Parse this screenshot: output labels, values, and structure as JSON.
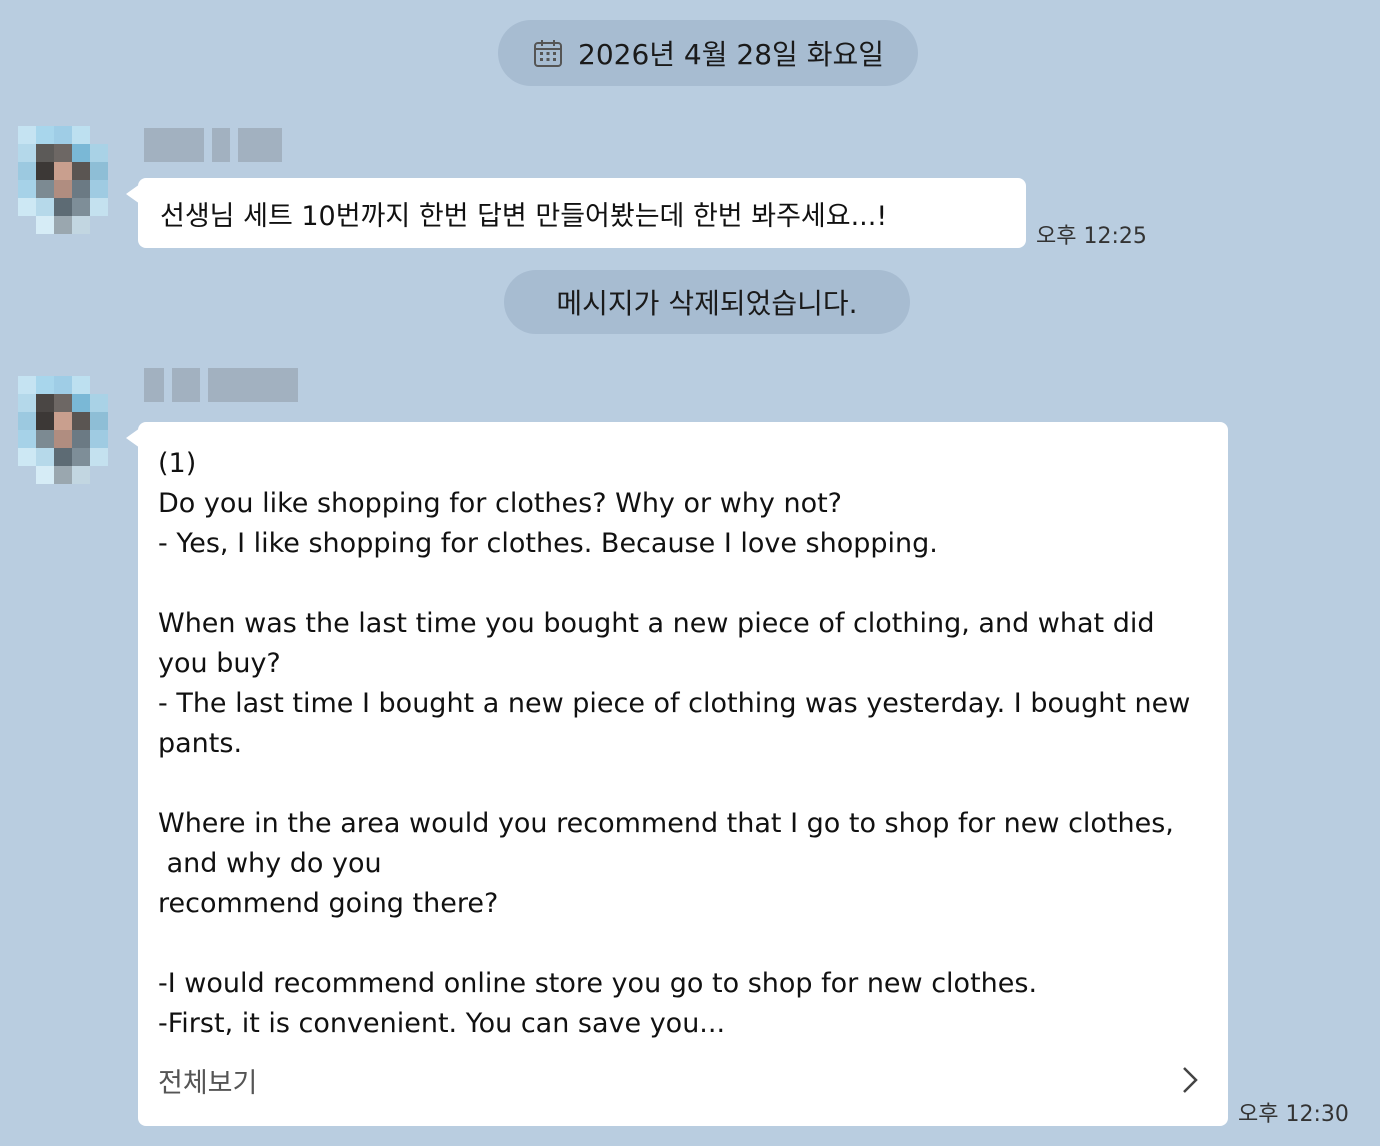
{
  "date_divider": {
    "label": "2026년 4월 28일 화요일",
    "icon": "calendar-icon"
  },
  "system_notice": {
    "label": "메시지가 삭제되었습니다."
  },
  "messages": [
    {
      "text": "선생님 세트 10번까지 한번 답변 만들어봤는데 한번 봐주세요...!",
      "time": "오후 12:25"
    },
    {
      "text": "(1)\nDo you like shopping for clothes? Why or why not?\n- Yes, I like shopping for clothes. Because I love shopping.\n\nWhen was the last time you bought a new piece of clothing, and what did you buy?\n- The last time I bought a new piece of clothing was yesterday. I bought new pants.\n\nWhere in the area would you recommend that I go to shop for new clothes,\n and why do you\nrecommend going there?\n\n-I would recommend online store you go to shop for new clothes.\n-First, it is convenient. You can save you...",
      "see_all_label": "전체보기",
      "time": "오후 12:30"
    }
  ],
  "colors": {
    "background": "#b9cde0",
    "pill": "#a7bcd1",
    "bubble": "#ffffff"
  }
}
